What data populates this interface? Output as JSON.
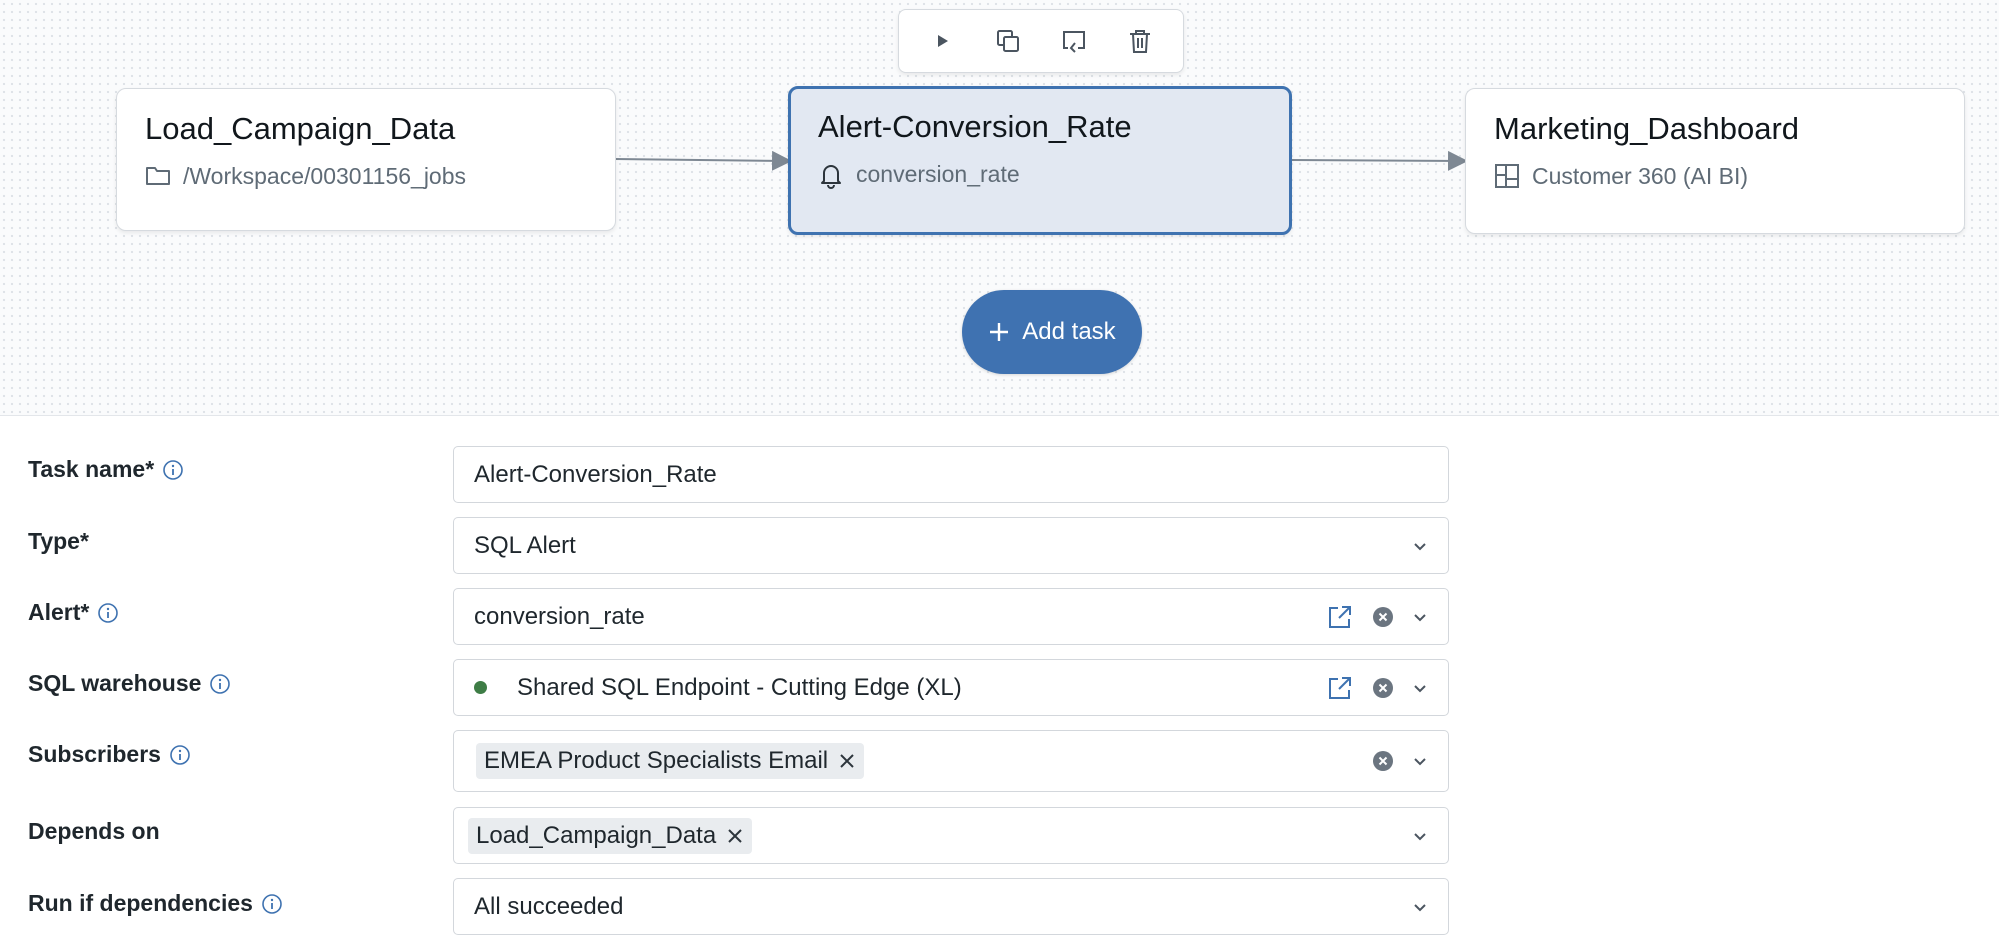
{
  "toolbar": {
    "run_icon": "play-icon",
    "clone_icon": "copy-icon",
    "repair_icon": "repair-run-icon",
    "delete_icon": "trash-icon"
  },
  "nodes": [
    {
      "title": "Load_Campaign_Data",
      "subtitle": "/Workspace/00301156_jobs",
      "icon": "folder-icon"
    },
    {
      "title": "Alert-Conversion_Rate",
      "subtitle": "conversion_rate",
      "icon": "bell-icon",
      "selected": true
    },
    {
      "title": "Marketing_Dashboard",
      "subtitle": "Customer 360 (AI BI)",
      "icon": "dashboard-icon"
    }
  ],
  "add_task": {
    "label": "Add task"
  },
  "form": {
    "task_name": {
      "label": "Task name*",
      "value": "Alert-Conversion_Rate"
    },
    "type": {
      "label": "Type*",
      "value": "SQL Alert"
    },
    "alert": {
      "label": "Alert*",
      "value": "conversion_rate"
    },
    "warehouse": {
      "label": "SQL warehouse",
      "value": "Shared SQL Endpoint - Cutting Edge (XL)",
      "status_color": "#3e7d46"
    },
    "subscribers": {
      "label": "Subscribers",
      "chips": [
        "EMEA Product Specialists Email"
      ]
    },
    "depends_on": {
      "label": "Depends on",
      "chips": [
        "Load_Campaign_Data"
      ]
    },
    "run_if": {
      "label": "Run if dependencies",
      "value": "All succeeded"
    }
  },
  "colors": {
    "accent": "#3f72b1",
    "selected_node_bg": "#e2e8f2",
    "info_icon": "#3e72b0"
  }
}
